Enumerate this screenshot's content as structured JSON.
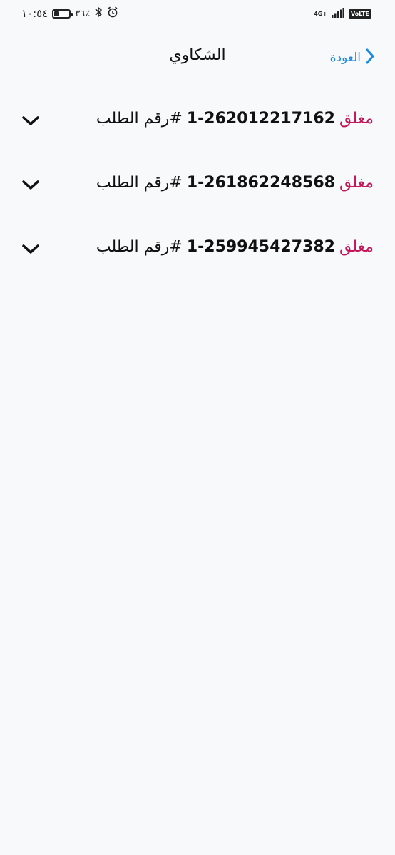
{
  "status_bar": {
    "time": "١٠:٥٤",
    "battery_percent_label": "٣٦٪",
    "battery_level": 0.36,
    "network_type": "4G+",
    "volte_label": "VoLTE",
    "icons": [
      "battery-icon",
      "bluetooth-icon",
      "alarm-icon",
      "signal-icon"
    ]
  },
  "header": {
    "title": "الشكاوي",
    "back_label": "العودة",
    "back_icon": "chevron-right-icon",
    "accent_color": "#1a8be0"
  },
  "complaints": [
    {
      "status": "مغلق",
      "number": "1-262012217162",
      "label": "#رقم الطلب"
    },
    {
      "status": "مغلق",
      "number": "1-261862248568",
      "label": "#رقم الطلب"
    },
    {
      "status": "مغلق",
      "number": "1-259945427382",
      "label": "#رقم الطلب"
    }
  ],
  "colors": {
    "status_closed": "#c2185b",
    "background": "#f8f9fb"
  }
}
